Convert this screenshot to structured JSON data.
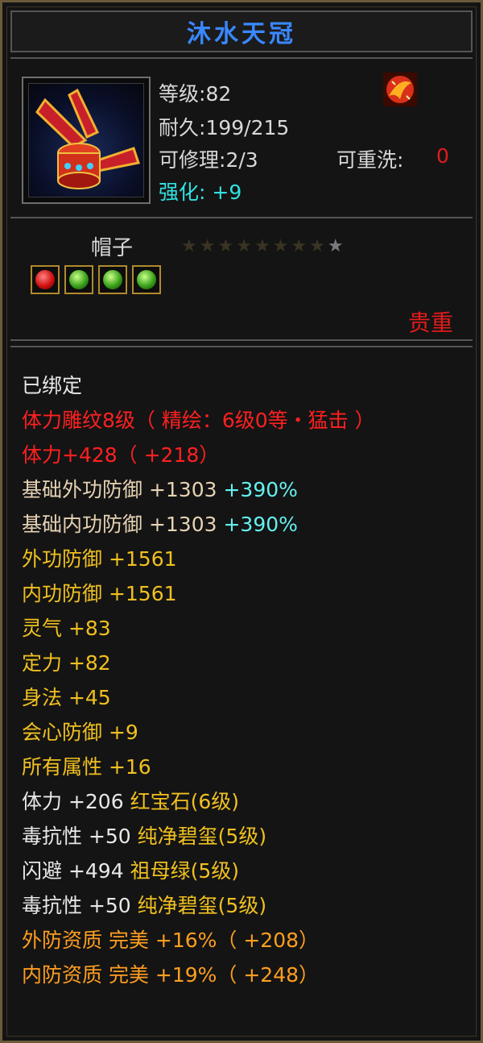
{
  "item": {
    "name": "沐水天冠",
    "level_label": "等级:",
    "level": "82",
    "durability_label": "耐久:",
    "durability": "199/215",
    "repair_label": "可修理:",
    "repair": "2/3",
    "reforge_label": "可重洗:",
    "reforge": "0",
    "enhance_label": "强化:",
    "enhance": "+9",
    "type": "帽子",
    "stars_total": 9,
    "stars_lit": 1,
    "gems": [
      "red",
      "green",
      "green",
      "green"
    ],
    "quality": "贵重"
  },
  "attributes": [
    {
      "text": "已绑定",
      "color": "#e8e8e8"
    },
    {
      "text": "体力雕纹8级（ 精绘：6级0等・猛击 ）",
      "color": "#ff2020"
    },
    {
      "text": "体力+428（ +218）",
      "color": "#ff2020"
    },
    {
      "text": "基础外功防御 +1303",
      "extra": " +390%",
      "color": "#e6d2b4"
    },
    {
      "text": "基础内功防御 +1303",
      "extra": " +390%",
      "color": "#e6d2b4"
    },
    {
      "text": "外功防御 +1561",
      "color": "#f0c020"
    },
    {
      "text": "内功防御 +1561",
      "color": "#f0c020"
    },
    {
      "text": "灵气 +83",
      "color": "#f0c020"
    },
    {
      "text": "定力 +82",
      "color": "#f0c020"
    },
    {
      "text": "身法 +45",
      "color": "#f0c020"
    },
    {
      "text": "会心防御 +9",
      "color": "#f0c020"
    },
    {
      "text": "所有属性 +16",
      "color": "#f0c020"
    },
    {
      "text": "体力 +206",
      "extra": " 红宝石(6级)",
      "color": "#e8e8e8"
    },
    {
      "text": "毒抗性 +50",
      "extra": " 纯净碧玺(5级)",
      "color": "#e8e8e8"
    },
    {
      "text": "闪避 +494",
      "extra": " 祖母绿(5级)",
      "color": "#e8e8e8"
    },
    {
      "text": "毒抗性 +50",
      "extra": " 纯净碧玺(5级)",
      "color": "#e8e8e8"
    },
    {
      "text": "外防资质  完美 +16%（ +208）",
      "color": "#ff9e20"
    },
    {
      "text": "内防资质  完美 +19%（ +248）",
      "color": "#ff9e20"
    }
  ],
  "colors": {
    "title": "#3a88ff",
    "cyan": "#66f0f0",
    "gem_text": "#f0c020"
  }
}
